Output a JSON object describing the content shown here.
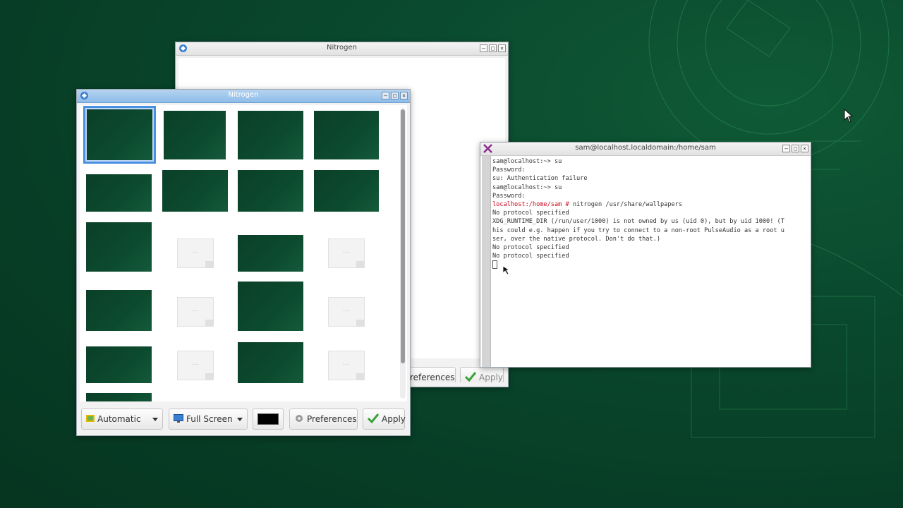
{
  "desktop": {},
  "nitrogen_back": {
    "title": "Nitrogen",
    "buttons": {
      "preferences": "references",
      "apply": "Apply"
    }
  },
  "nitrogen_front": {
    "title": "Nitrogen",
    "toolbar": {
      "zoom_mode": "Automatic",
      "xinerama": "Full Screen",
      "preferences": "Preferences",
      "apply": "Apply"
    },
    "bg_color": "#000000"
  },
  "terminal": {
    "title": "sam@localhost.localdomain:/home/sam",
    "lines": [
      "sam@localhost:~> su",
      "Password:",
      "su: Authentication failure",
      "sam@localhost:~> su",
      "Password:"
    ],
    "root_prompt": "localhost:/home/sam #",
    "root_command": " nitrogen /usr/share/wallpapers",
    "output": [
      "No protocol specified",
      "XDG_RUNTIME_DIR (/run/user/1000) is not owned by us (uid 0), but by uid 1000! (T",
      "his could e.g. happen if you try to connect to a non-root PulseAudio as a root u",
      "ser, over the native protocol. Don't do that.)",
      "No protocol specified",
      "No protocol specified"
    ]
  },
  "colors": {
    "desktop": "#0a4a2e",
    "selection": "#4a90e2",
    "root_prompt": "#d0021b",
    "active_title": "#8ebde9"
  }
}
